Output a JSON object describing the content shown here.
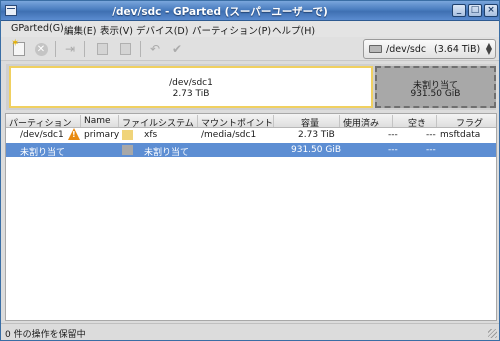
{
  "window": {
    "title": "/dev/sdc - GParted (スーパーユーザーで)",
    "buttons": {
      "minimize": "_",
      "maximize": "□",
      "close": "×"
    }
  },
  "menubar": {
    "items": [
      {
        "label": "GParted(G)"
      },
      {
        "label": "編集(E)"
      },
      {
        "label": "表示(V)"
      },
      {
        "label": "デバイス(D)"
      },
      {
        "label": "パーティション(P)"
      },
      {
        "label": "ヘルプ(H)"
      }
    ]
  },
  "toolbar": {
    "icons": [
      "new-icon",
      "delete-icon",
      "resize-move-icon",
      "copy-icon",
      "paste-icon",
      "undo-icon",
      "apply-icon"
    ],
    "device": {
      "name": "/dev/sdc",
      "size": "(3.64 TiB)"
    }
  },
  "map": {
    "sdc1": {
      "name": "/dev/sdc1",
      "size": "2.73 TiB"
    },
    "unallocated": {
      "name": "未割り当て",
      "size": "931.50 GiB"
    }
  },
  "table": {
    "columns": [
      "パーティション",
      "Name",
      "ファイルシステム",
      "マウントポイント",
      "容量",
      "使用済み",
      "空き",
      "フラグ"
    ],
    "rows": [
      {
        "partition": "/dev/sdc1",
        "name": "primary",
        "filesystem": "xfs",
        "mount": "/media/sdc1",
        "size": "2.73 TiB",
        "used": "---",
        "free": "---",
        "flags": "msftdata",
        "swatch": "#f0d47a",
        "warning": true
      },
      {
        "partition": "未割り当て",
        "name": "",
        "filesystem": "未割り当て",
        "mount": "",
        "size": "931.50 GiB",
        "used": "---",
        "free": "---",
        "flags": "",
        "swatch": "#a8a8a8",
        "warning": false
      }
    ]
  },
  "status": {
    "text": "0 件の操作を保留中"
  }
}
